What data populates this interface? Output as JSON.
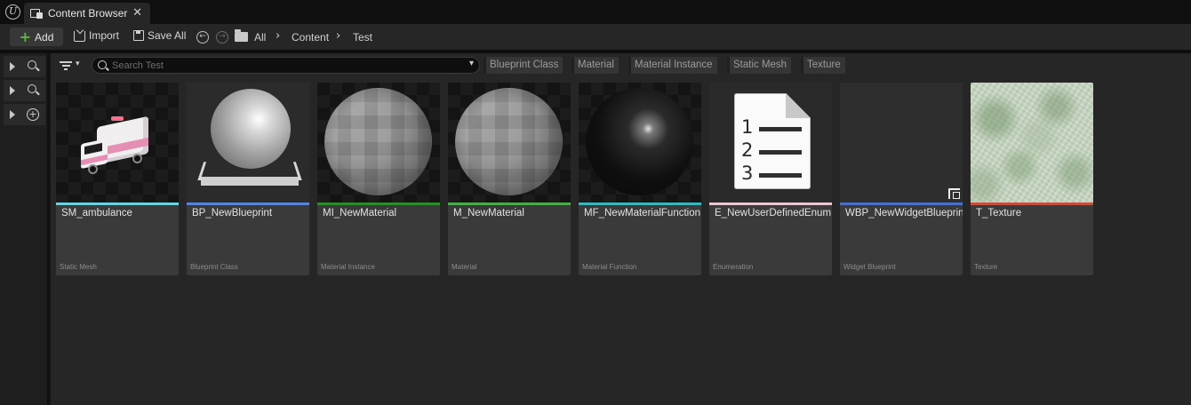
{
  "tab": {
    "title": "Content Browser",
    "close_glyph": "✕",
    "icon": "content-browser-icon"
  },
  "toolbar": {
    "add_label": "Add",
    "import_label": "Import",
    "save_all_label": "Save All",
    "nav_back_glyph": "←",
    "nav_forward_glyph": "→",
    "breadcrumbs": [
      "All",
      "Content",
      "Test"
    ],
    "crumb_separator": "›"
  },
  "search": {
    "placeholder": "Search Test",
    "value": "",
    "dropdown_glyph": "▾"
  },
  "filter": {
    "chevron_glyph": "▾"
  },
  "filter_chips": [
    "Blueprint Class",
    "Material",
    "Material Instance",
    "Static Mesh",
    "Texture"
  ],
  "sidebar": {
    "rows": [
      {
        "icon": "search-icon"
      },
      {
        "icon": "search-icon"
      },
      {
        "icon": "add-circle-icon",
        "glyph": "+"
      }
    ]
  },
  "assets": [
    {
      "name": "SM_ambulance",
      "type": "Static Mesh",
      "color": "#6fd0dd"
    },
    {
      "name": "BP_NewBlueprint",
      "type": "Blueprint Class",
      "color": "#5b84d6"
    },
    {
      "name": "MI_NewMaterial",
      "type": "Material Instance",
      "color": "#2f8a2f"
    },
    {
      "name": "M_NewMaterial",
      "type": "Material",
      "color": "#4fa84f"
    },
    {
      "name": "MF_NewMaterialFunction",
      "type": "Material Function",
      "color": "#3fb3b8"
    },
    {
      "name": "E_NewUserDefinedEnum",
      "type": "Enumeration",
      "color": "#e9c9cf"
    },
    {
      "name": "WBP_NewWidgetBlueprint",
      "type": "Widget Blueprint",
      "color": "#4a6fc4"
    },
    {
      "name": "T_Texture",
      "type": "Texture",
      "color": "#c25040"
    }
  ],
  "enum_doc": {
    "numbers": [
      "1",
      "2",
      "3"
    ]
  },
  "colors": {
    "add_plus": "#5fb344",
    "panel": "#262626",
    "background": "#151515"
  }
}
